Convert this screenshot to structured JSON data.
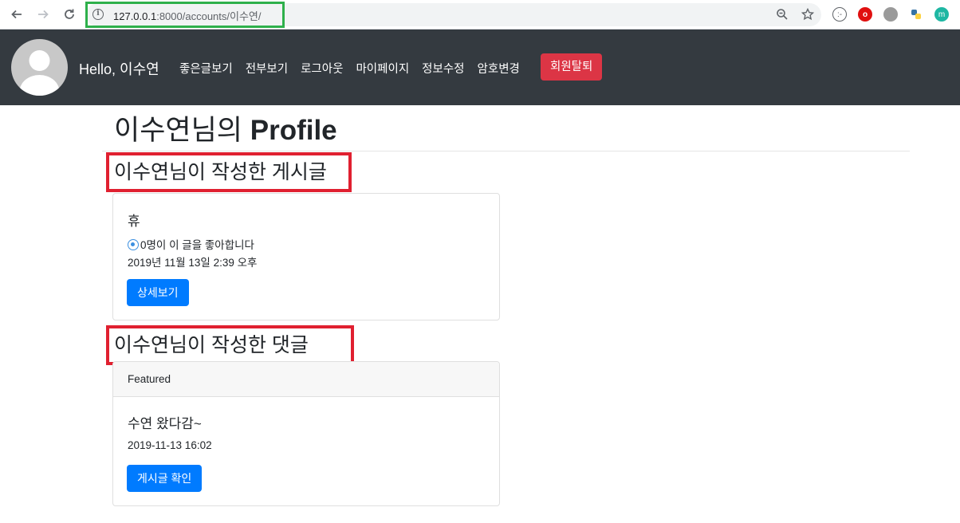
{
  "browser": {
    "url_host": "127.0.0.1",
    "url_rest": ":8000/accounts/이수연/",
    "back_icon": "back-arrow-icon",
    "forward_icon": "forward-arrow-icon",
    "reload_icon": "reload-icon"
  },
  "navbar": {
    "brand": "Hello, 이수연",
    "links": [
      "좋은글보기",
      "전부보기",
      "로그아웃",
      "마이페이지",
      "정보수정",
      "암호변경"
    ],
    "danger_button": "회원탈퇴",
    "colors": {
      "background": "#343a40",
      "danger": "#dc3545"
    }
  },
  "page": {
    "title_prefix": "이수연님의 ",
    "title_bold": "Profile"
  },
  "posts_section": {
    "heading": "이수연님이 작성한 게시글",
    "card": {
      "title": "휴",
      "likes_text": "0명이 이 글을 좋아합니다",
      "date": "2019년 11월 13일 2:39 오후",
      "button": "상세보기"
    }
  },
  "comments_section": {
    "heading": "이수연님이 작성한 댓글",
    "card": {
      "header": "Featured",
      "title": "수연 왔다감~",
      "date": "2019-11-13 16:02",
      "button": "게시글 확인"
    }
  },
  "colors": {
    "primary": "#007bff",
    "highlight_red": "#e02030",
    "highlight_green": "#2eb04b"
  }
}
